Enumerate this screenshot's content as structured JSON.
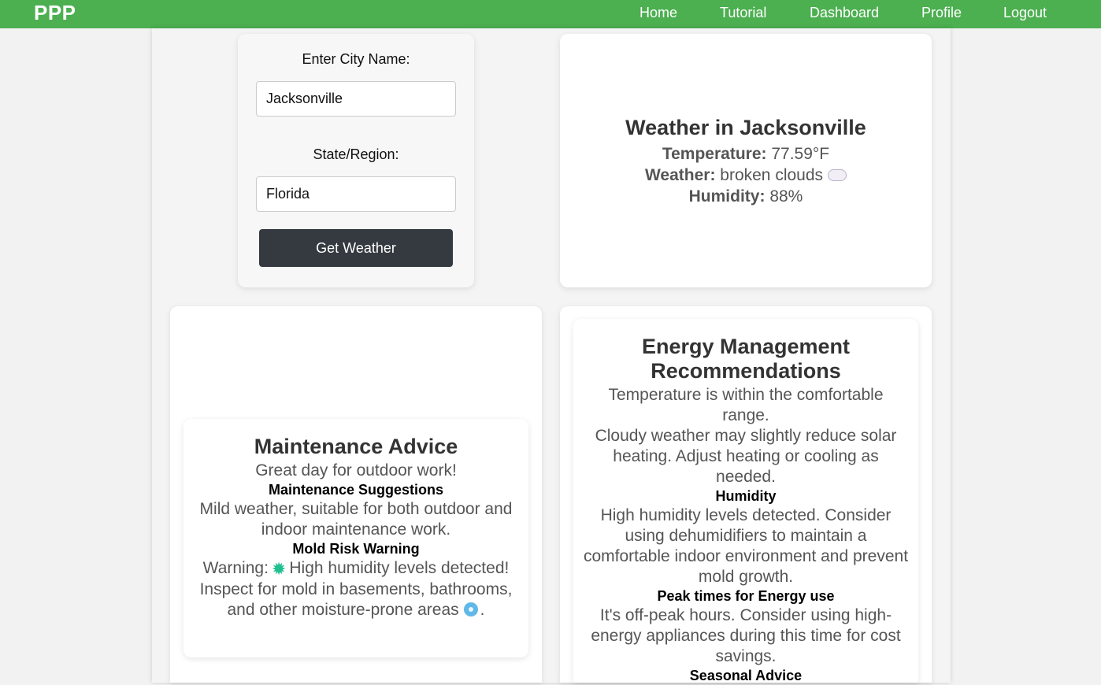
{
  "nav": {
    "brand": "PPP",
    "links": [
      "Home",
      "Tutorial",
      "Dashboard",
      "Profile",
      "Logout"
    ]
  },
  "form": {
    "city_label": "Enter City Name:",
    "city_value": "Jacksonville",
    "state_label": "State/Region:",
    "state_value": "Florida",
    "submit_label": "Get Weather"
  },
  "weather": {
    "title": "Weather in Jacksonville",
    "temperature_label": "Temperature:",
    "temperature_value": "77.59°F",
    "condition_label": "Weather:",
    "condition_value": "broken clouds",
    "condition_icon": "cloud-icon",
    "humidity_label": "Humidity:",
    "humidity_value": "88%"
  },
  "maintenance": {
    "title": "Maintenance Advice",
    "summary": "Great day for outdoor work!",
    "suggestions_heading": "Maintenance Suggestions",
    "suggestions_text": "Mild weather, suitable for both outdoor and indoor maintenance work.",
    "mold_heading": "Mold Risk Warning",
    "mold_prefix": "Warning:",
    "mold_text": "High humidity levels detected! Inspect for mold in basements, bathrooms, and other moisture-prone areas",
    "mold_suffix": ".",
    "mold_icon": "mold-icon",
    "water_icon": "water-drop-icon"
  },
  "energy": {
    "title": "Energy Management Recommendations",
    "temp_text": "Temperature is within the comfortable range.",
    "cloud_text": "Cloudy weather may slightly reduce solar heating. Adjust heating or cooling as needed.",
    "humidity_heading": "Humidity",
    "humidity_text": "High humidity levels detected. Consider using dehumidifiers to maintain a comfortable indoor environment and prevent mold growth.",
    "peak_heading": "Peak times for Energy use",
    "peak_text": "It's off-peak hours. Consider using high-energy appliances during this time for cost savings.",
    "seasonal_heading": "Seasonal Advice"
  },
  "colors": {
    "navbar": "#4caf50",
    "button": "#343a40"
  }
}
